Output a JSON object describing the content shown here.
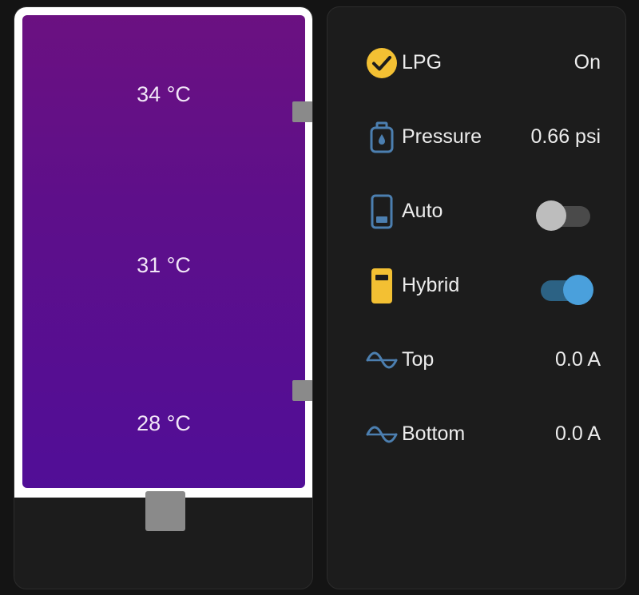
{
  "tank": {
    "temps": [
      "34 °C",
      "31 °C",
      "28 °C"
    ],
    "colors": {
      "frame": "#ffffff",
      "top": "#6b1181",
      "bottom": "#510e97",
      "port": "#8a8a8a"
    }
  },
  "entities": [
    {
      "label": "LPG",
      "value": "On",
      "icon": "check-circle-icon",
      "icon_color": "#f3c033"
    },
    {
      "label": "Pressure",
      "value": "0.66 psi",
      "icon": "gas-cylinder-icon",
      "icon_color": "#4c7fb0"
    },
    {
      "label": "Auto",
      "icon": "phone-battery-icon",
      "icon_color": "#4c7fb0",
      "toggle": "off"
    },
    {
      "label": "Hybrid",
      "icon": "battery-low-icon",
      "icon_color": "#f3c033",
      "toggle": "on"
    },
    {
      "label": "Top",
      "value": "0.0 A",
      "icon": "sine-wave-icon",
      "icon_color": "#4c7fb0"
    },
    {
      "label": "Bottom",
      "value": "0.0 A",
      "icon": "sine-wave-icon",
      "icon_color": "#4c7fb0"
    }
  ],
  "colors": {
    "background": "#141414",
    "card": "#1c1c1c",
    "toggle_on": "#4aa0dc",
    "toggle_off": "#bdbdbd"
  }
}
